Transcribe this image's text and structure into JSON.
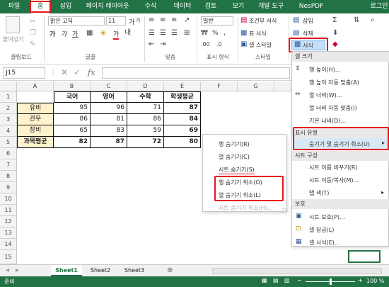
{
  "tabs": [
    "파일",
    "홈",
    "삽입",
    "페이지 레이아웃",
    "수식",
    "데이터",
    "검토",
    "보기",
    "개발 도구",
    "NesPDF",
    "로그인"
  ],
  "ribbon": {
    "paste": "붙여넣기",
    "clipboard": "클립보드",
    "font_name": "맑은 고딕",
    "font_size": "11",
    "font_group": "글꼴",
    "bold": "가",
    "italic": "가",
    "underline": "가",
    "grow": "가",
    "shrink": "가",
    "fill_char": "가",
    "align_group": "맞춤",
    "number_format": "일반",
    "percent": "%",
    "comma": ",",
    "number_group": "표시 형식",
    "cond_format": "조건부 서식",
    "table_format": "표 서식",
    "cell_style": "셀 스타일",
    "style_group": "스타일",
    "insert": "삽입",
    "delete": "삭제",
    "format": "서식"
  },
  "namebox": "J15",
  "fx": "fx",
  "columns": [
    "A",
    "B",
    "C",
    "D",
    "E",
    "F",
    "G"
  ],
  "rows": [
    "1",
    "2",
    "3",
    "4",
    "5",
    "6",
    "7",
    "8",
    "9",
    "10",
    "11",
    "12",
    "13",
    "14",
    "15"
  ],
  "table": {
    "headers": [
      "국어",
      "영어",
      "수학",
      "학생평균"
    ],
    "rows": [
      {
        "name": "유비",
        "v": [
          "95",
          "96",
          "71",
          "87"
        ]
      },
      {
        "name": "관우",
        "v": [
          "86",
          "81",
          "86",
          "84"
        ]
      },
      {
        "name": "장비",
        "v": [
          "65",
          "83",
          "59",
          "69"
        ]
      },
      {
        "name": "과목평균",
        "v": [
          "82",
          "87",
          "72",
          "80"
        ]
      }
    ]
  },
  "hide_menu": {
    "items": [
      "행 숨기기(R)",
      "열 숨기기(C)",
      "시트 숨기기(S)",
      "행 숨기기 취소(O)",
      "열 숨기기 취소(L)",
      "시트 숨기기 취소(H)..."
    ]
  },
  "format_menu": {
    "sec_size": "셀 크기",
    "row_height": "행 높이(H)...",
    "row_autofit": "행 높이 자동 맞춤(A)",
    "col_width": "열 너비(W)...",
    "col_autofit": "열 너비 자동 맞춤(I)",
    "default_width": "기본 너비(D)...",
    "sec_visibility": "표시 유형",
    "hide_unhide": "숨기기 및 숨기기 취소(U)",
    "sec_org": "시트 구성",
    "rename": "시트 이름 바꾸기(R)",
    "move_copy": "시트 이동/복사(M)...",
    "tab_color": "탭 색(T)",
    "sec_protect": "보호",
    "protect_sheet": "시트 보호(P)...",
    "lock_cell": "셀 잠금(L)",
    "format_cells": "셀 서식(E)..."
  },
  "sheets": [
    "Sheet1",
    "Sheet2",
    "Sheet3"
  ],
  "status": {
    "ready": "준비",
    "zoom": "100 %"
  },
  "colors": {
    "accent": "#217346",
    "highlight": "#e8141c",
    "header_fill": "#fff2cc"
  }
}
